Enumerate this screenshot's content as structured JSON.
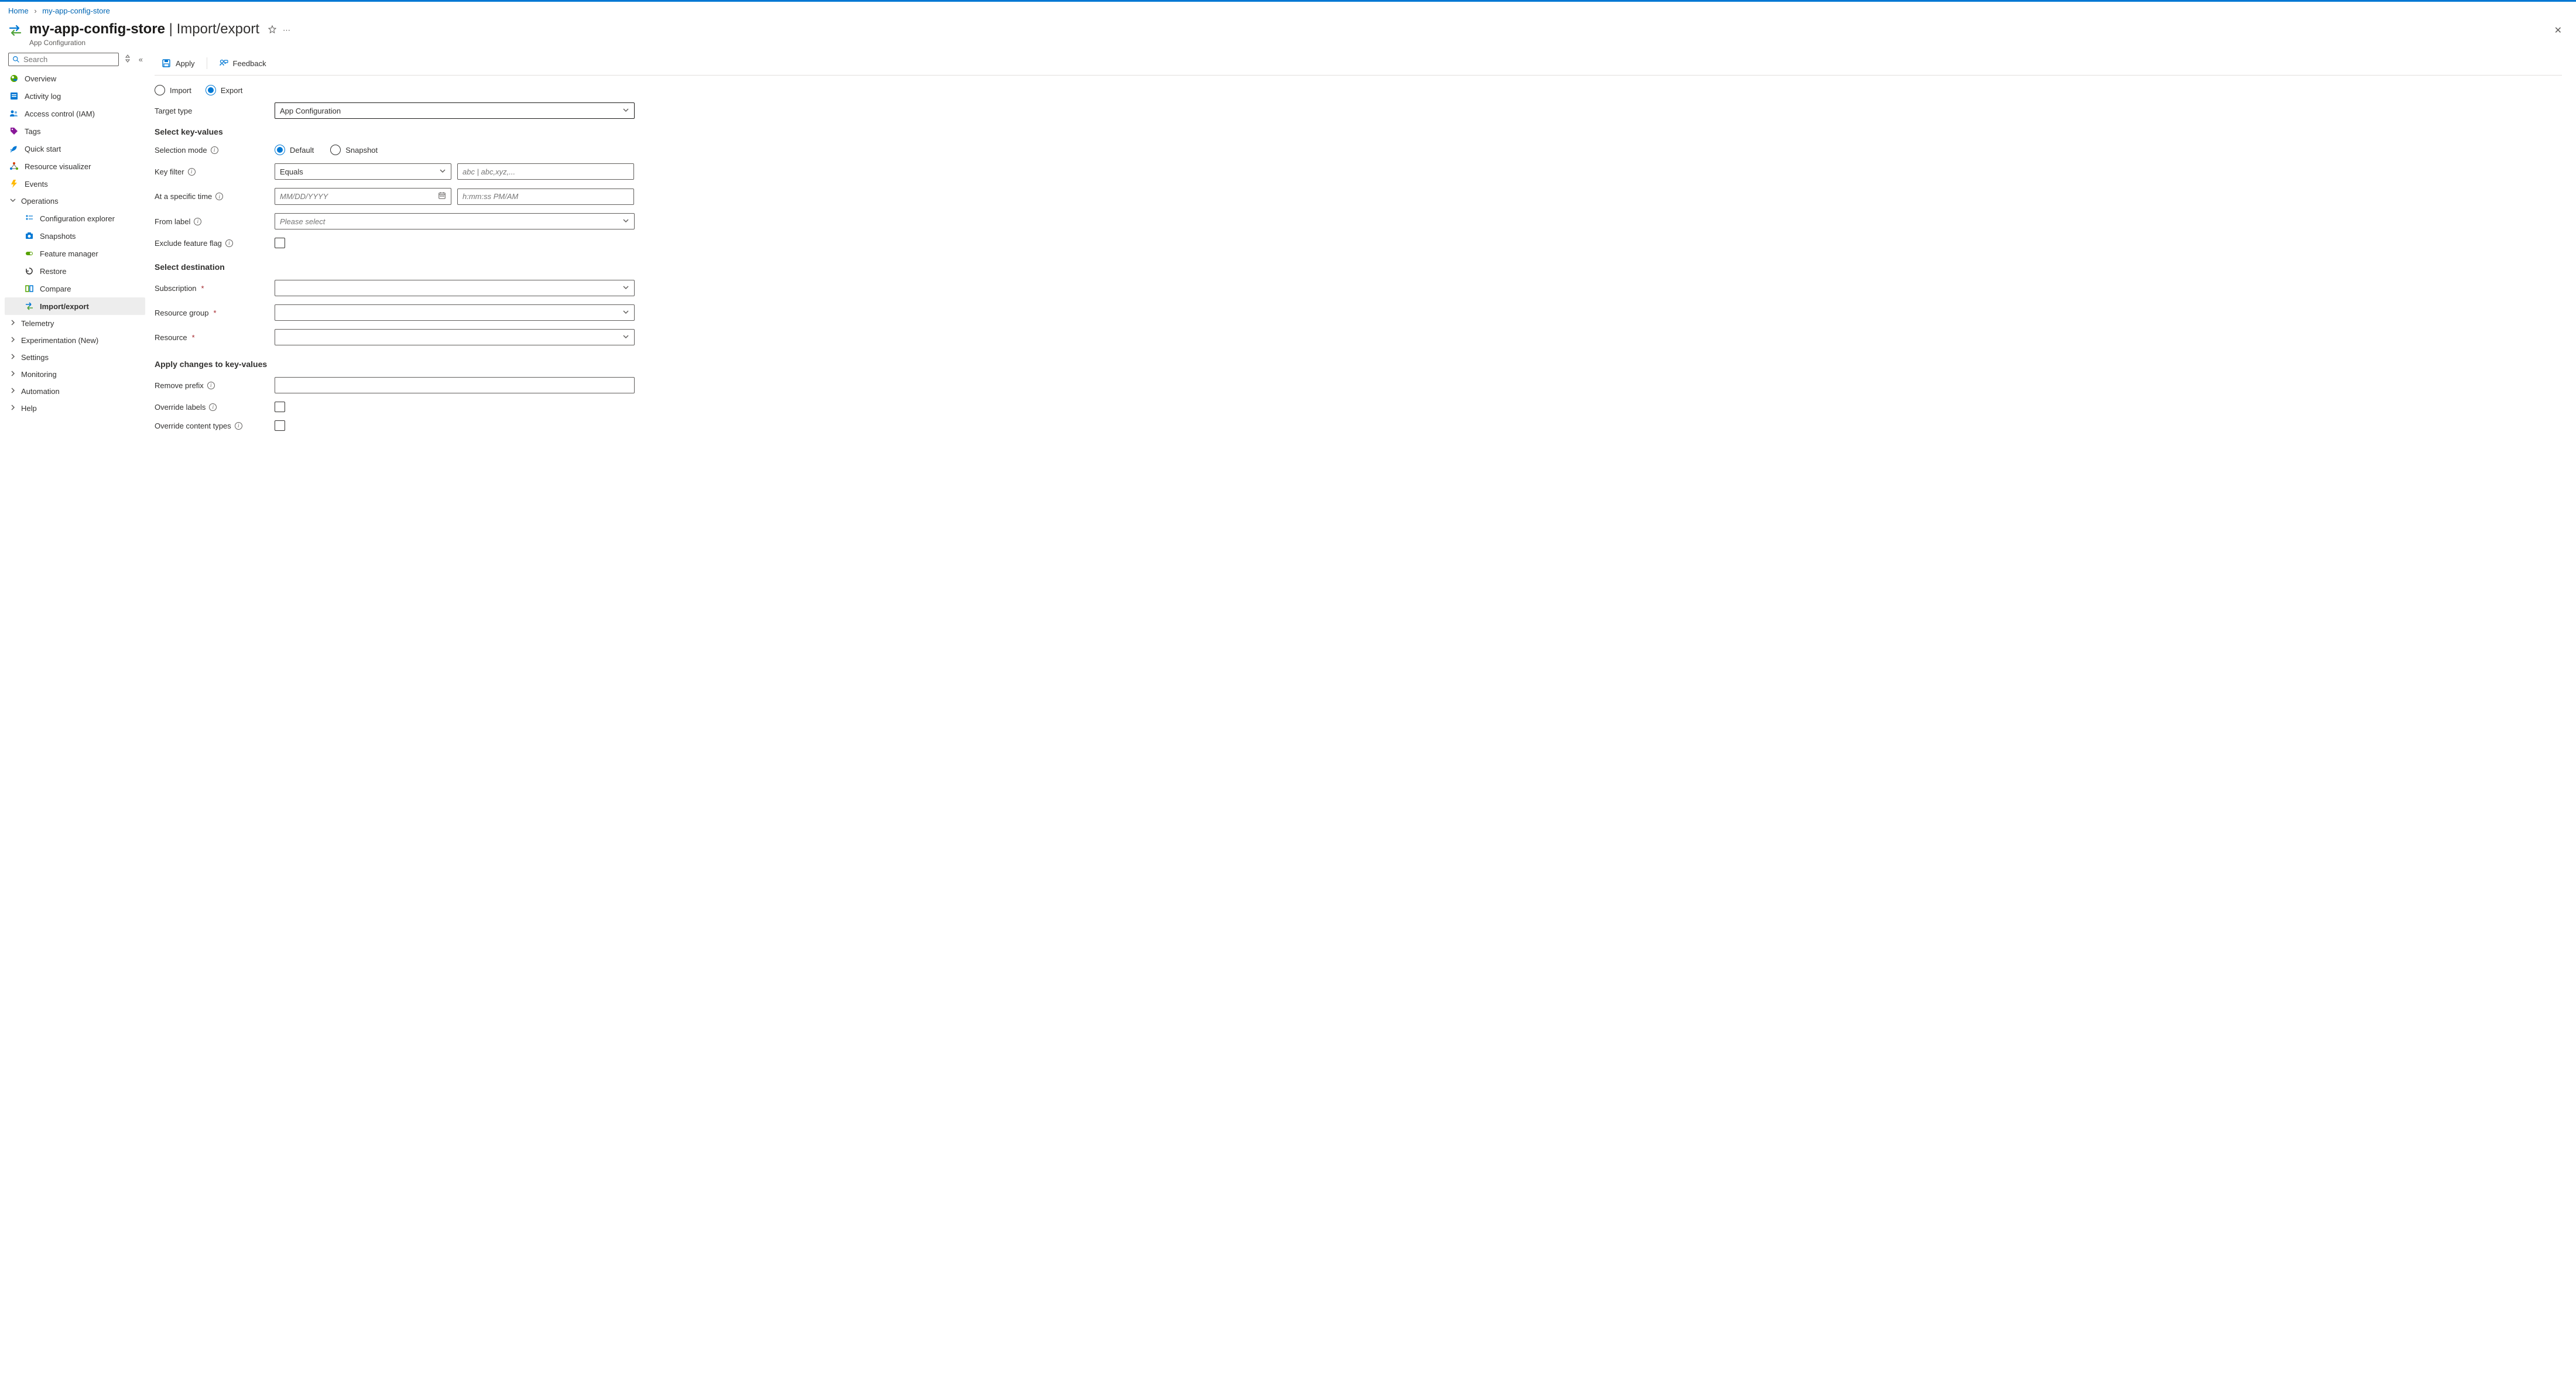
{
  "breadcrumb": {
    "home": "Home",
    "store": "my-app-config-store"
  },
  "header": {
    "title_main": "my-app-config-store",
    "title_sep": " | ",
    "title_section": "Import/export",
    "subtitle": "App Configuration"
  },
  "sidebar": {
    "search_placeholder": "Search",
    "items": {
      "overview": "Overview",
      "activity": "Activity log",
      "iam": "Access control (IAM)",
      "tags": "Tags",
      "quickstart": "Quick start",
      "resviz": "Resource visualizer",
      "events": "Events",
      "operations": "Operations",
      "config_explorer": "Configuration explorer",
      "snapshots": "Snapshots",
      "feature_manager": "Feature manager",
      "restore": "Restore",
      "compare": "Compare",
      "import_export": "Import/export",
      "telemetry": "Telemetry",
      "experimentation": "Experimentation (New)",
      "settings": "Settings",
      "monitoring": "Monitoring",
      "automation": "Automation",
      "help": "Help"
    }
  },
  "toolbar": {
    "apply": "Apply",
    "feedback": "Feedback"
  },
  "radios": {
    "import": "Import",
    "export": "Export",
    "default": "Default",
    "snapshot": "Snapshot"
  },
  "labels": {
    "target_type": "Target type",
    "section_select_kv": "Select key-values",
    "selection_mode": "Selection mode",
    "key_filter": "Key filter",
    "at_time": "At a specific time",
    "from_label": "From label",
    "exclude_ff": "Exclude feature flag",
    "section_dest": "Select destination",
    "subscription": "Subscription",
    "resource_group": "Resource group",
    "resource": "Resource",
    "section_apply": "Apply changes to key-values",
    "remove_prefix": "Remove prefix",
    "override_labels": "Override labels",
    "override_ct": "Override content types"
  },
  "values": {
    "target_type": "App Configuration",
    "key_filter_op": "Equals",
    "key_filter_placeholder": "abc | abc,xyz,...",
    "date_placeholder": "MM/DD/YYYY",
    "time_placeholder": "h:mm:ss PM/AM",
    "from_label_placeholder": "Please select"
  }
}
